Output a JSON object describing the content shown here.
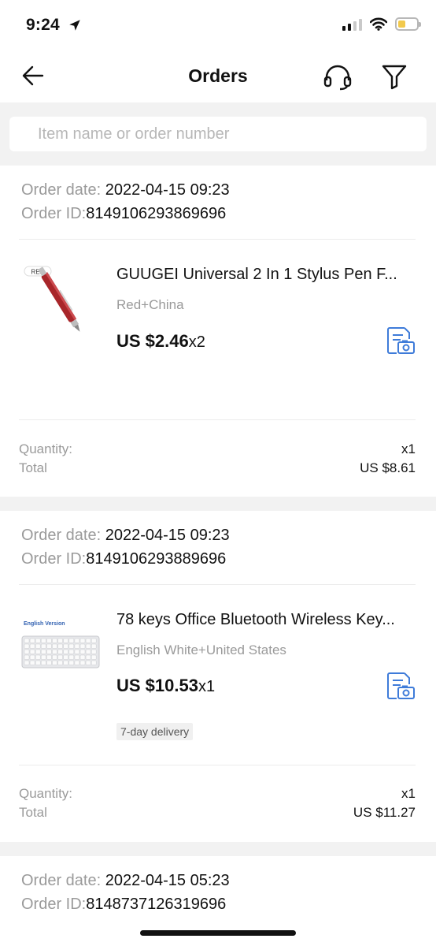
{
  "status_bar": {
    "time": "9:24",
    "location_icon": "location-arrow-icon",
    "signal_icon": "cellular-signal-icon",
    "wifi_icon": "wifi-icon",
    "battery_icon": "battery-low-icon",
    "battery_level": 0.25,
    "battery_color": "#f2c94c"
  },
  "nav": {
    "title": "Orders",
    "back_icon": "back-arrow-icon",
    "support_icon": "headset-icon",
    "filter_icon": "filter-icon"
  },
  "search": {
    "placeholder": "Item name or order number",
    "value": ""
  },
  "orders": [
    {
      "order_date_label": "Order date: ",
      "order_date": "2022-04-15 09:23",
      "order_id_label": "Order ID:",
      "order_id": "8149106293869696",
      "product": {
        "thumb_badge": "RED",
        "name": "GUUGEI Universal 2 In 1 Stylus Pen F...",
        "variant": "Red+China",
        "price": "US $2.46",
        "qty": "x2",
        "review_icon": "photo-review-icon"
      },
      "quantity_label": "Quantity:",
      "quantity": "x1",
      "total_label": "Total",
      "total": "US $8.61"
    },
    {
      "order_date_label": "Order date: ",
      "order_date": "2022-04-15 09:23",
      "order_id_label": "Order ID:",
      "order_id": "8149106293889696",
      "product": {
        "thumb_badge": "English Version",
        "name": "78 keys Office Bluetooth Wireless Key...",
        "variant": "English White+United States",
        "price": "US $10.53",
        "qty": "x1",
        "review_icon": "photo-review-icon",
        "delivery_badge": "7-day delivery"
      },
      "quantity_label": "Quantity:",
      "quantity": "x1",
      "total_label": "Total",
      "total": "US $11.27"
    },
    {
      "order_date_label": "Order date: ",
      "order_date": "2022-04-15 05:23",
      "order_id_label": "Order ID:",
      "order_id": "8148737126319696"
    }
  ],
  "colors": {
    "accent_icon": "#3e7bd9",
    "muted_text": "#9a9a9a",
    "separator": "#f2f2f2"
  }
}
